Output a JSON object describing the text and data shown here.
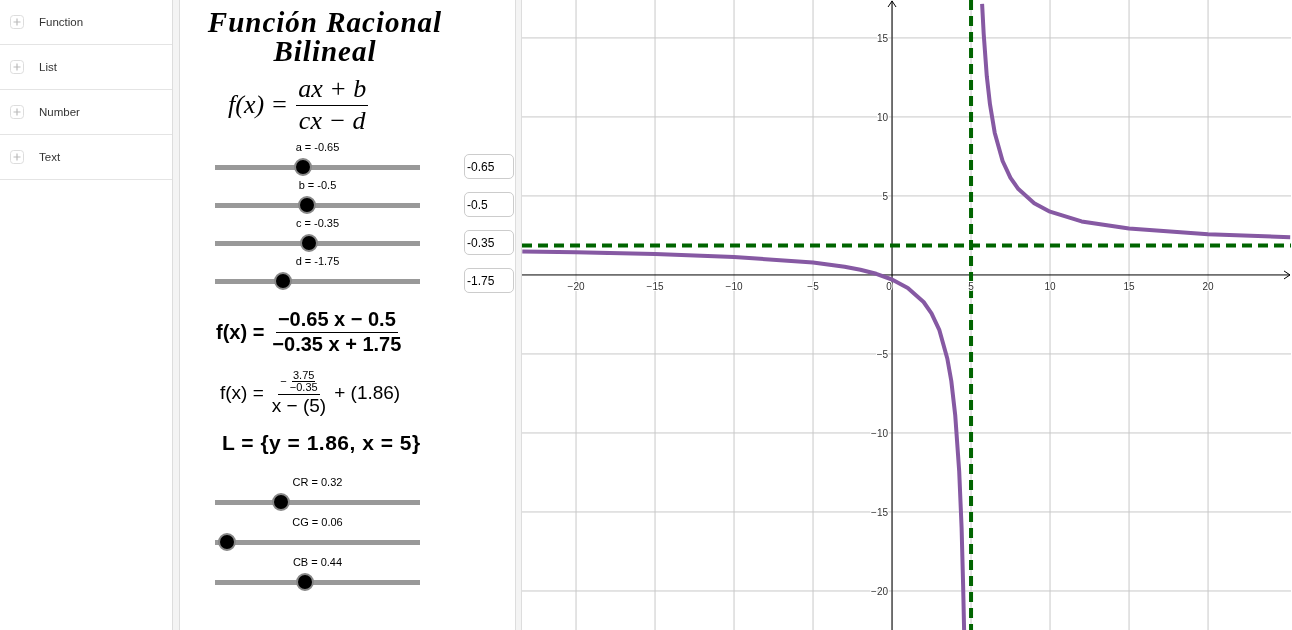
{
  "sidebar": {
    "items": [
      {
        "label": "Function"
      },
      {
        "label": "List"
      },
      {
        "label": "Number"
      },
      {
        "label": "Text"
      }
    ]
  },
  "panel": {
    "title": "Función Racional Bilineal",
    "definition": {
      "lhs": "f(x) =",
      "numerator": "ax + b",
      "denominator": "cx − d"
    },
    "sliders": [
      {
        "label": "a = -0.65",
        "level": 0.43,
        "input": "-0.65"
      },
      {
        "label": "b = -0.5",
        "level": 0.45,
        "input": "-0.5"
      },
      {
        "label": "c = -0.35",
        "level": 0.46,
        "input": "-0.35"
      },
      {
        "label": "d = -1.75",
        "level": 0.33,
        "input": "-1.75"
      }
    ],
    "expanded_form": {
      "lhs": "f(x) =",
      "numerator": "−0.65 x − 0.5",
      "denominator": "−0.35 x + 1.75"
    },
    "asymptote_form": {
      "lhs": "f(x) =",
      "sign": "−",
      "inner_numerator": "3.75",
      "inner_denominator": "−0.35",
      "denominator": "x − (5)",
      "rest": "+ (1.86)"
    },
    "asymptotes_set": "L = {y = 1.86, x = 5}",
    "color_sliders": [
      {
        "label": "CR = 0.32",
        "level": 0.32
      },
      {
        "label": "CG = 0.06",
        "level": 0.06
      },
      {
        "label": "CB = 0.44",
        "level": 0.44
      }
    ]
  },
  "graph": {
    "chart_data": {
      "type": "line",
      "x": [
        -23.4,
        -20,
        -15,
        -10,
        -5,
        -3,
        -2,
        -1,
        0,
        1,
        2,
        2.5,
        3,
        3.5,
        3.75,
        4,
        4.25,
        4.4,
        4.5,
        4.56,
        5,
        5.7,
        5.8,
        6,
        6.2,
        6.5,
        7,
        7.5,
        8,
        9,
        10,
        12,
        15,
        20,
        25.2
      ],
      "series": [
        {
          "color": "#8659a3",
          "values": [
            1.48,
            1.43,
            1.32,
            1.14,
            0.79,
            0.52,
            0.33,
            0.07,
            -0.29,
            -0.82,
            -1.71,
            -2.43,
            -3.5,
            -5.29,
            -6.71,
            -8.86,
            -12.43,
            -16.0,
            -19.57,
            -22.47,
            null,
            17.16,
            15.25,
            12.57,
            10.79,
            9.0,
            7.21,
            6.14,
            5.43,
            4.54,
            4.0,
            3.39,
            2.93,
            2.57,
            2.39
          ]
        }
      ],
      "grid": true,
      "xlim": [
        -23.42,
        25.25
      ],
      "ylim": [
        -22.47,
        17.4
      ],
      "xticks": [
        {
          "value": -20,
          "label": "−20"
        },
        {
          "value": -15,
          "label": "−15"
        },
        {
          "value": -10,
          "label": "−10"
        },
        {
          "value": -5,
          "label": "−5"
        },
        {
          "value": 0,
          "label": "0"
        },
        {
          "value": 5,
          "label": "5"
        },
        {
          "value": 10,
          "label": "10"
        },
        {
          "value": 15,
          "label": "15"
        },
        {
          "value": 20,
          "label": "20"
        }
      ],
      "yticks": [
        {
          "value": -20,
          "label": "−20"
        },
        {
          "value": -15,
          "label": "−15"
        },
        {
          "value": -10,
          "label": "−10"
        },
        {
          "value": -5,
          "label": "−5"
        },
        {
          "value": 5,
          "label": "5"
        },
        {
          "value": 10,
          "label": "10"
        },
        {
          "value": 15,
          "label": "15"
        }
      ],
      "ref_lines": [
        {
          "axis": "y",
          "value": 1.86,
          "color": "#006400"
        },
        {
          "axis": "x",
          "value": 5,
          "color": "#006400"
        }
      ]
    }
  }
}
